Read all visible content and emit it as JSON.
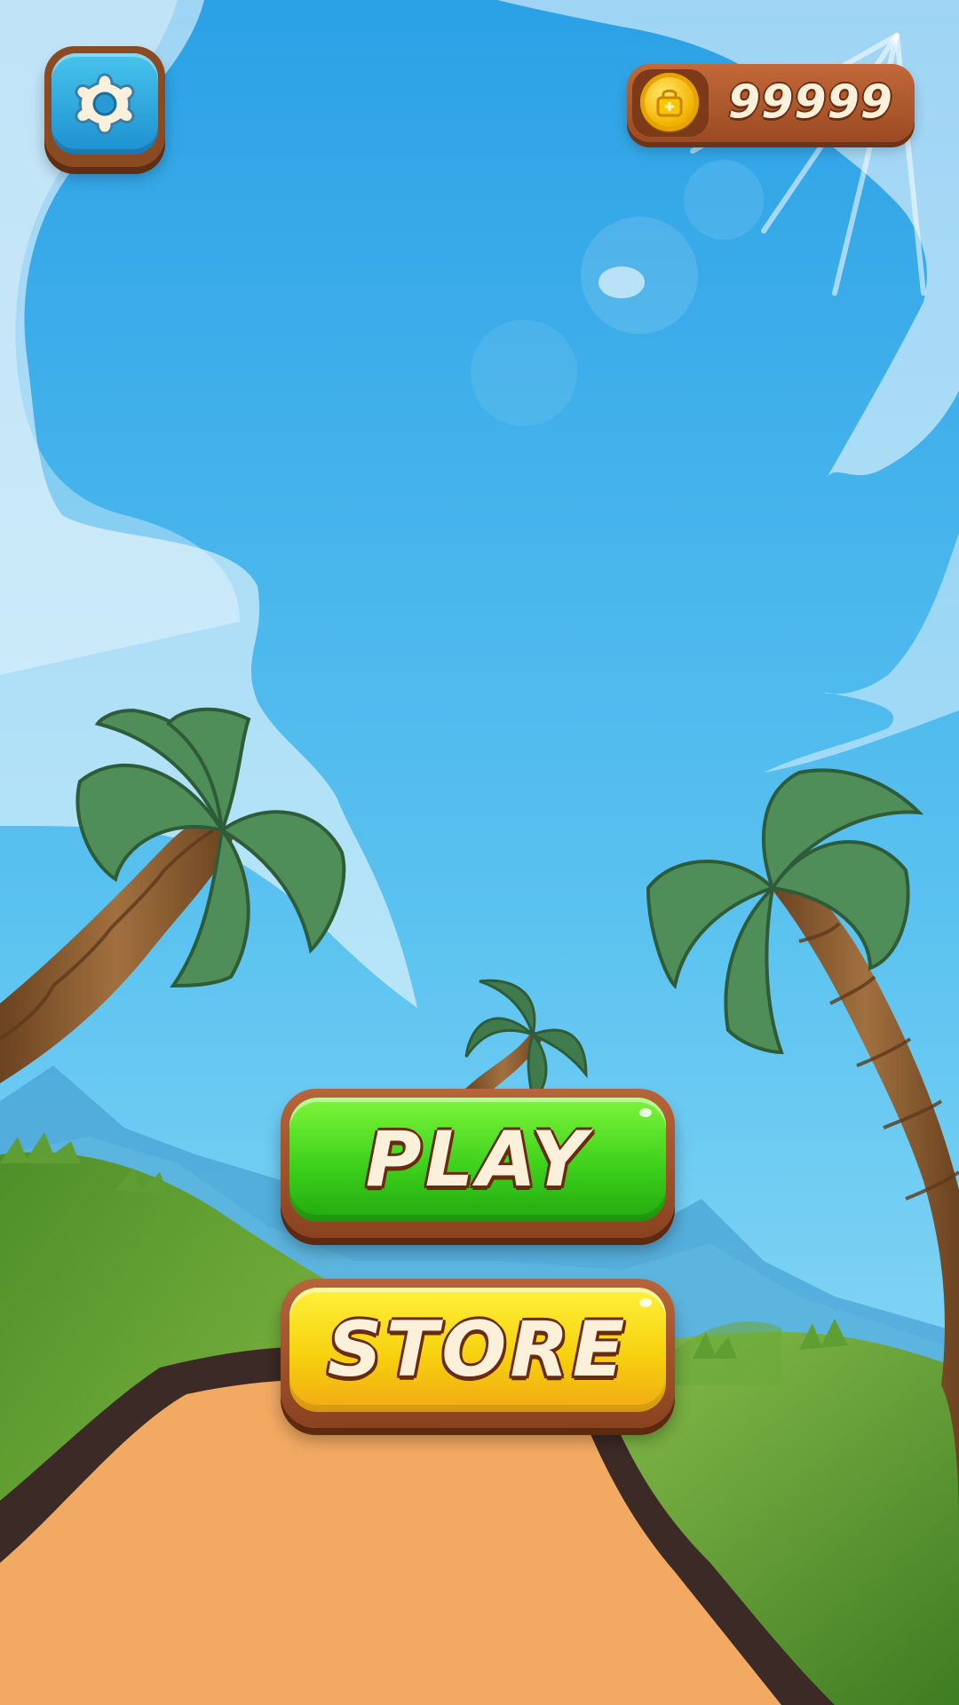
{
  "hud": {
    "settings_icon": "gear-icon",
    "coin_icon": "coin-icon",
    "coin_count": "99999"
  },
  "menu": {
    "play_label": "PLAY",
    "store_label": "STORE"
  },
  "colors": {
    "sky_top": "#2ba1e6",
    "sky_bottom": "#8fdcf6",
    "play_green": "#3ed11b",
    "store_yellow": "#f6d10e",
    "wood": "#9c4a23",
    "path": "#f2a962"
  }
}
